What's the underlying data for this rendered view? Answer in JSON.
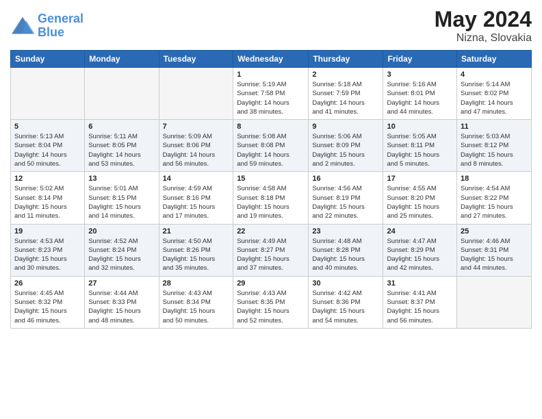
{
  "header": {
    "logo_line1": "General",
    "logo_line2": "Blue",
    "title": "May 2024",
    "location": "Nizna, Slovakia"
  },
  "weekdays": [
    "Sunday",
    "Monday",
    "Tuesday",
    "Wednesday",
    "Thursday",
    "Friday",
    "Saturday"
  ],
  "weeks": [
    [
      {
        "day": "",
        "info": ""
      },
      {
        "day": "",
        "info": ""
      },
      {
        "day": "",
        "info": ""
      },
      {
        "day": "1",
        "info": "Sunrise: 5:19 AM\nSunset: 7:58 PM\nDaylight: 14 hours\nand 38 minutes."
      },
      {
        "day": "2",
        "info": "Sunrise: 5:18 AM\nSunset: 7:59 PM\nDaylight: 14 hours\nand 41 minutes."
      },
      {
        "day": "3",
        "info": "Sunrise: 5:16 AM\nSunset: 8:01 PM\nDaylight: 14 hours\nand 44 minutes."
      },
      {
        "day": "4",
        "info": "Sunrise: 5:14 AM\nSunset: 8:02 PM\nDaylight: 14 hours\nand 47 minutes."
      }
    ],
    [
      {
        "day": "5",
        "info": "Sunrise: 5:13 AM\nSunset: 8:04 PM\nDaylight: 14 hours\nand 50 minutes."
      },
      {
        "day": "6",
        "info": "Sunrise: 5:11 AM\nSunset: 8:05 PM\nDaylight: 14 hours\nand 53 minutes."
      },
      {
        "day": "7",
        "info": "Sunrise: 5:09 AM\nSunset: 8:06 PM\nDaylight: 14 hours\nand 56 minutes."
      },
      {
        "day": "8",
        "info": "Sunrise: 5:08 AM\nSunset: 8:08 PM\nDaylight: 14 hours\nand 59 minutes."
      },
      {
        "day": "9",
        "info": "Sunrise: 5:06 AM\nSunset: 8:09 PM\nDaylight: 15 hours\nand 2 minutes."
      },
      {
        "day": "10",
        "info": "Sunrise: 5:05 AM\nSunset: 8:11 PM\nDaylight: 15 hours\nand 5 minutes."
      },
      {
        "day": "11",
        "info": "Sunrise: 5:03 AM\nSunset: 8:12 PM\nDaylight: 15 hours\nand 8 minutes."
      }
    ],
    [
      {
        "day": "12",
        "info": "Sunrise: 5:02 AM\nSunset: 8:14 PM\nDaylight: 15 hours\nand 11 minutes."
      },
      {
        "day": "13",
        "info": "Sunrise: 5:01 AM\nSunset: 8:15 PM\nDaylight: 15 hours\nand 14 minutes."
      },
      {
        "day": "14",
        "info": "Sunrise: 4:59 AM\nSunset: 8:16 PM\nDaylight: 15 hours\nand 17 minutes."
      },
      {
        "day": "15",
        "info": "Sunrise: 4:58 AM\nSunset: 8:18 PM\nDaylight: 15 hours\nand 19 minutes."
      },
      {
        "day": "16",
        "info": "Sunrise: 4:56 AM\nSunset: 8:19 PM\nDaylight: 15 hours\nand 22 minutes."
      },
      {
        "day": "17",
        "info": "Sunrise: 4:55 AM\nSunset: 8:20 PM\nDaylight: 15 hours\nand 25 minutes."
      },
      {
        "day": "18",
        "info": "Sunrise: 4:54 AM\nSunset: 8:22 PM\nDaylight: 15 hours\nand 27 minutes."
      }
    ],
    [
      {
        "day": "19",
        "info": "Sunrise: 4:53 AM\nSunset: 8:23 PM\nDaylight: 15 hours\nand 30 minutes."
      },
      {
        "day": "20",
        "info": "Sunrise: 4:52 AM\nSunset: 8:24 PM\nDaylight: 15 hours\nand 32 minutes."
      },
      {
        "day": "21",
        "info": "Sunrise: 4:50 AM\nSunset: 8:26 PM\nDaylight: 15 hours\nand 35 minutes."
      },
      {
        "day": "22",
        "info": "Sunrise: 4:49 AM\nSunset: 8:27 PM\nDaylight: 15 hours\nand 37 minutes."
      },
      {
        "day": "23",
        "info": "Sunrise: 4:48 AM\nSunset: 8:28 PM\nDaylight: 15 hours\nand 40 minutes."
      },
      {
        "day": "24",
        "info": "Sunrise: 4:47 AM\nSunset: 8:29 PM\nDaylight: 15 hours\nand 42 minutes."
      },
      {
        "day": "25",
        "info": "Sunrise: 4:46 AM\nSunset: 8:31 PM\nDaylight: 15 hours\nand 44 minutes."
      }
    ],
    [
      {
        "day": "26",
        "info": "Sunrise: 4:45 AM\nSunset: 8:32 PM\nDaylight: 15 hours\nand 46 minutes."
      },
      {
        "day": "27",
        "info": "Sunrise: 4:44 AM\nSunset: 8:33 PM\nDaylight: 15 hours\nand 48 minutes."
      },
      {
        "day": "28",
        "info": "Sunrise: 4:43 AM\nSunset: 8:34 PM\nDaylight: 15 hours\nand 50 minutes."
      },
      {
        "day": "29",
        "info": "Sunrise: 4:43 AM\nSunset: 8:35 PM\nDaylight: 15 hours\nand 52 minutes."
      },
      {
        "day": "30",
        "info": "Sunrise: 4:42 AM\nSunset: 8:36 PM\nDaylight: 15 hours\nand 54 minutes."
      },
      {
        "day": "31",
        "info": "Sunrise: 4:41 AM\nSunset: 8:37 PM\nDaylight: 15 hours\nand 56 minutes."
      },
      {
        "day": "",
        "info": ""
      }
    ]
  ]
}
